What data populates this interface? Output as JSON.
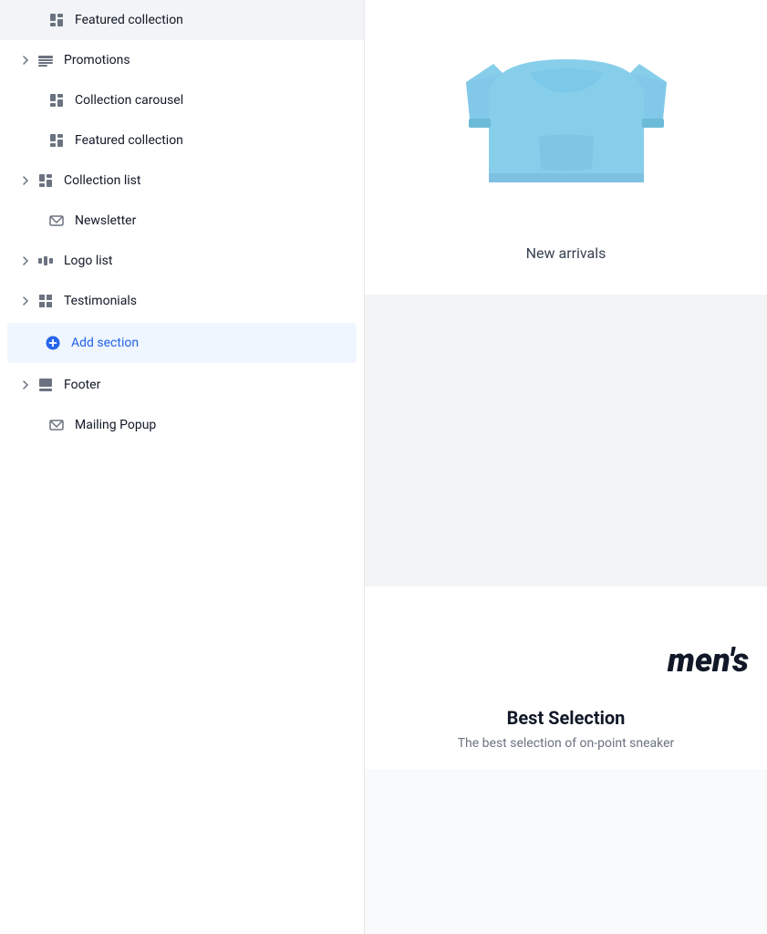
{
  "sidebar": {
    "items": [
      {
        "id": "featured-collection-1",
        "label": "Featured collection",
        "icon": "layout-icon",
        "hasChevron": false,
        "indented": true,
        "active": false
      },
      {
        "id": "promotions",
        "label": "Promotions",
        "icon": "promotions-icon",
        "hasChevron": true,
        "indented": false,
        "active": false
      },
      {
        "id": "collection-carousel",
        "label": "Collection carousel",
        "icon": "layout-icon",
        "hasChevron": false,
        "indented": true,
        "active": false
      },
      {
        "id": "featured-collection-2",
        "label": "Featured collection",
        "icon": "layout-icon",
        "hasChevron": false,
        "indented": true,
        "active": false
      },
      {
        "id": "collection-list",
        "label": "Collection list",
        "icon": "layout-icon",
        "hasChevron": true,
        "indented": false,
        "active": false
      },
      {
        "id": "newsletter",
        "label": "Newsletter",
        "icon": "mail-icon",
        "hasChevron": false,
        "indented": true,
        "active": false
      },
      {
        "id": "logo-list",
        "label": "Logo list",
        "icon": "logo-icon",
        "hasChevron": true,
        "indented": false,
        "active": false
      },
      {
        "id": "testimonials",
        "label": "Testimonials",
        "icon": "grid-icon",
        "hasChevron": true,
        "indented": false,
        "active": false
      },
      {
        "id": "add-section",
        "label": "Add section",
        "icon": "plus-circle-icon",
        "hasChevron": false,
        "indented": false,
        "isAddSection": true,
        "active": true
      },
      {
        "id": "footer",
        "label": "Footer",
        "icon": "footer-icon",
        "hasChevron": true,
        "indented": false,
        "active": false
      },
      {
        "id": "mailing-popup",
        "label": "Mailing Popup",
        "icon": "mail-icon",
        "hasChevron": false,
        "indented": true,
        "active": false
      }
    ]
  },
  "preview": {
    "new_arrivals_label": "New arrivals",
    "mens_title": "men's",
    "best_selection_title": "Best Selection",
    "best_selection_desc": "The best selection of on-point sneaker"
  }
}
